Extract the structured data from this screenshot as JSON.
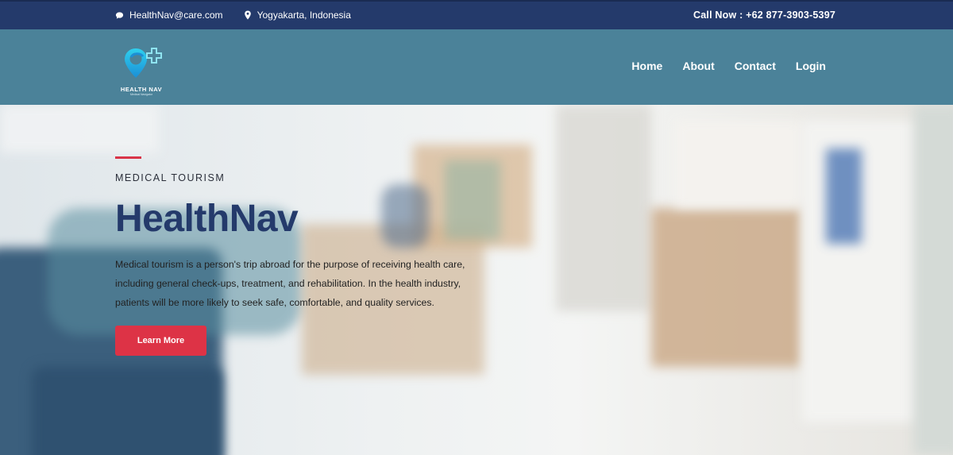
{
  "topbar": {
    "email": "HealthNav@care.com",
    "location": "Yogyakarta, Indonesia",
    "call": "Call Now : +62 877-3903-5397",
    "email_icon": "chat-bubble-icon",
    "location_icon": "map-pin-icon"
  },
  "brand": {
    "name": "HEALTH NAV",
    "tagline": "Medical Navigator"
  },
  "nav": {
    "items": [
      {
        "label": "Home"
      },
      {
        "label": "About"
      },
      {
        "label": "Contact"
      },
      {
        "label": "Login"
      }
    ]
  },
  "hero": {
    "eyebrow": "MEDICAL TOURISM",
    "title": "HealthNav",
    "description": "Medical tourism is a person's trip abroad for the purpose of receiving health care, including general check-ups, treatment, and rehabilitation. In the health industry, patients will be more likely to seek safe, comfortable, and quality services.",
    "cta_label": "Learn More"
  },
  "colors": {
    "topbar": "#243a6b",
    "navbar": "#4b8299",
    "accent": "#dd3346",
    "title": "#243a6b"
  }
}
